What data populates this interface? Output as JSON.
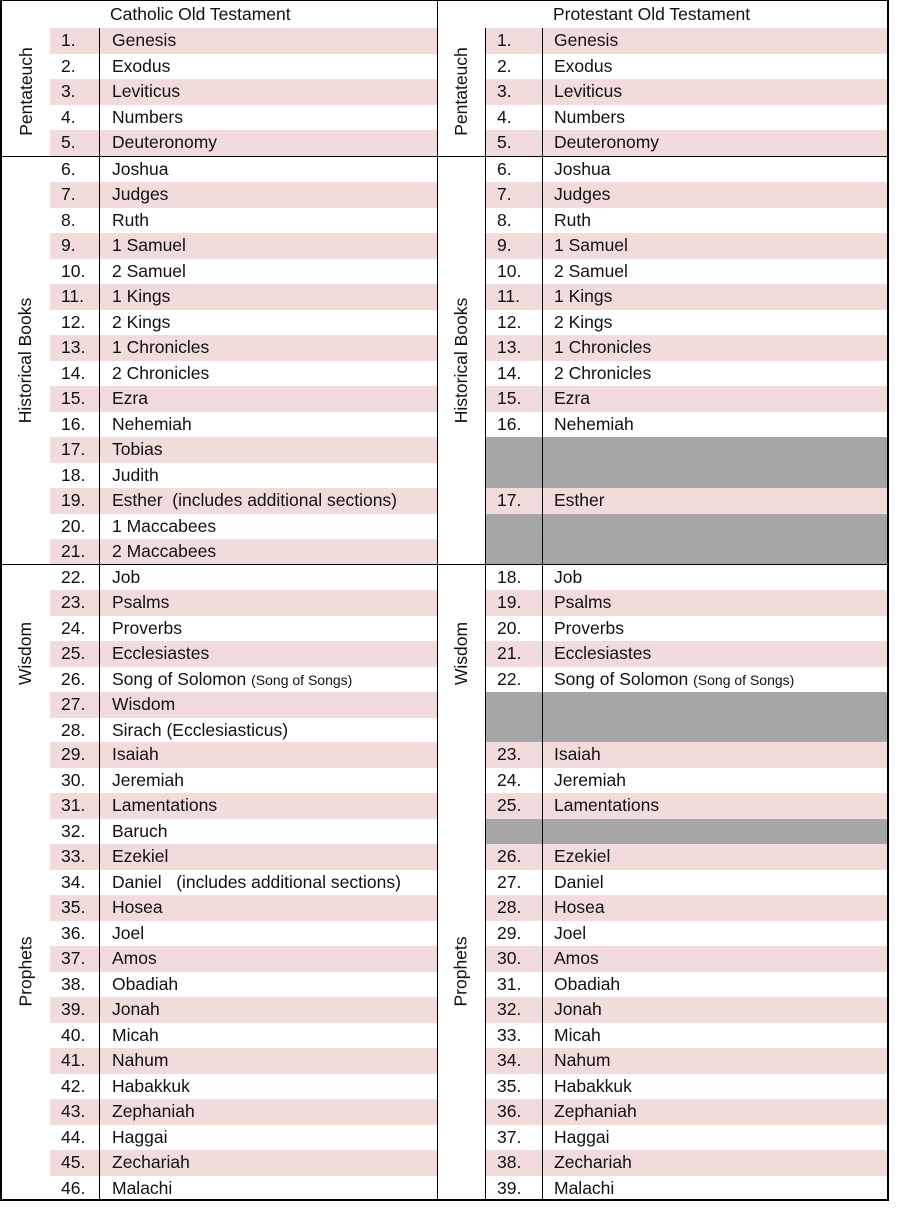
{
  "colors": {
    "stripe": "#f2dcdb",
    "missing": "#a6a6a6",
    "border": "#000000"
  },
  "catholic": {
    "title": "Catholic Old Testament",
    "sections": [
      {
        "label": "Pentateuch",
        "rows": [
          {
            "num": "1.",
            "name": "Genesis"
          },
          {
            "num": "2.",
            "name": "Exodus"
          },
          {
            "num": "3.",
            "name": "Leviticus"
          },
          {
            "num": "4.",
            "name": "Numbers"
          },
          {
            "num": "5.",
            "name": "Deuteronomy"
          }
        ]
      },
      {
        "label": "Historical Books",
        "rows": [
          {
            "num": "6.",
            "name": "Joshua"
          },
          {
            "num": "7.",
            "name": "Judges"
          },
          {
            "num": "8.",
            "name": "Ruth"
          },
          {
            "num": "9.",
            "name": "1 Samuel"
          },
          {
            "num": "10.",
            "name": "2 Samuel"
          },
          {
            "num": "11.",
            "name": "1 Kings"
          },
          {
            "num": "12.",
            "name": "2 Kings"
          },
          {
            "num": "13.",
            "name": "1 Chronicles"
          },
          {
            "num": "14.",
            "name": "2 Chronicles"
          },
          {
            "num": "15.",
            "name": "Ezra"
          },
          {
            "num": "16.",
            "name": "Nehemiah"
          },
          {
            "num": "17.",
            "name": "Tobias"
          },
          {
            "num": "18.",
            "name": "Judith"
          },
          {
            "num": "19.",
            "name": "Esther  (includes additional sections)"
          },
          {
            "num": "20.",
            "name": "1 Maccabees"
          },
          {
            "num": "21.",
            "name": "2 Maccabees"
          }
        ]
      },
      {
        "label": "Wisdom",
        "rows": [
          {
            "num": "22.",
            "name": "Job"
          },
          {
            "num": "23.",
            "name": "Psalms"
          },
          {
            "num": "24.",
            "name": "Proverbs"
          },
          {
            "num": "25.",
            "name": "Ecclesiastes"
          },
          {
            "num": "26.",
            "name": "Song of Solomon",
            "note": "(Song of Songs)"
          },
          {
            "num": "27.",
            "name": "Wisdom"
          },
          {
            "num": "28.",
            "name": "Sirach (Ecclesiasticus)"
          }
        ]
      },
      {
        "label": "Prophets",
        "rows": [
          {
            "num": "29.",
            "name": "Isaiah"
          },
          {
            "num": "30.",
            "name": "Jeremiah"
          },
          {
            "num": "31.",
            "name": "Lamentations"
          },
          {
            "num": "32.",
            "name": "Baruch"
          },
          {
            "num": "33.",
            "name": "Ezekiel"
          },
          {
            "num": "34.",
            "name": "Daniel   (includes additional sections)"
          },
          {
            "num": "35.",
            "name": "Hosea"
          },
          {
            "num": "36.",
            "name": "Joel"
          },
          {
            "num": "37.",
            "name": "Amos"
          },
          {
            "num": "38.",
            "name": "Obadiah"
          },
          {
            "num": "39.",
            "name": "Jonah"
          },
          {
            "num": "40.",
            "name": "Micah"
          },
          {
            "num": "41.",
            "name": "Nahum"
          },
          {
            "num": "42.",
            "name": "Habakkuk"
          },
          {
            "num": "43.",
            "name": "Zephaniah"
          },
          {
            "num": "44.",
            "name": "Haggai"
          },
          {
            "num": "45.",
            "name": "Zechariah"
          },
          {
            "num": "46.",
            "name": "Malachi"
          }
        ]
      }
    ]
  },
  "protestant": {
    "title": "Protestant Old Testament",
    "sections": [
      {
        "label": "Pentateuch",
        "rows": [
          {
            "num": "1.",
            "name": "Genesis"
          },
          {
            "num": "2.",
            "name": "Exodus"
          },
          {
            "num": "3.",
            "name": "Leviticus"
          },
          {
            "num": "4.",
            "name": "Numbers"
          },
          {
            "num": "5.",
            "name": "Deuteronomy"
          }
        ]
      },
      {
        "label": "Historical Books",
        "rows": [
          {
            "num": "6.",
            "name": "Joshua"
          },
          {
            "num": "7.",
            "name": "Judges"
          },
          {
            "num": "8.",
            "name": "Ruth"
          },
          {
            "num": "9.",
            "name": "1 Samuel"
          },
          {
            "num": "10.",
            "name": "2 Samuel"
          },
          {
            "num": "11.",
            "name": "1 Kings"
          },
          {
            "num": "12.",
            "name": "2 Kings"
          },
          {
            "num": "13.",
            "name": "1 Chronicles"
          },
          {
            "num": "14.",
            "name": "2 Chronicles"
          },
          {
            "num": "15.",
            "name": "Ezra"
          },
          {
            "num": "16.",
            "name": "Nehemiah"
          },
          {
            "missing": true
          },
          {
            "missing": true
          },
          {
            "num": "17.",
            "name": "Esther"
          },
          {
            "missing": true
          },
          {
            "missing": true
          }
        ]
      },
      {
        "label": "Wisdom",
        "rows": [
          {
            "num": "18.",
            "name": "Job"
          },
          {
            "num": "19.",
            "name": "Psalms"
          },
          {
            "num": "20.",
            "name": "Proverbs"
          },
          {
            "num": "21.",
            "name": "Ecclesiastes"
          },
          {
            "num": "22.",
            "name": "Song of Solomon",
            "note": "(Song of Songs)"
          },
          {
            "missing": true
          },
          {
            "missing": true
          }
        ]
      },
      {
        "label": "Prophets",
        "rows": [
          {
            "num": "23.",
            "name": "Isaiah"
          },
          {
            "num": "24.",
            "name": "Jeremiah"
          },
          {
            "num": "25.",
            "name": "Lamentations"
          },
          {
            "missing": true
          },
          {
            "num": "26.",
            "name": "Ezekiel"
          },
          {
            "num": "27.",
            "name": "Daniel"
          },
          {
            "num": "28.",
            "name": "Hosea"
          },
          {
            "num": "29.",
            "name": "Joel"
          },
          {
            "num": "30.",
            "name": "Amos"
          },
          {
            "num": "31.",
            "name": "Obadiah"
          },
          {
            "num": "32.",
            "name": "Jonah"
          },
          {
            "num": "33.",
            "name": "Micah"
          },
          {
            "num": "34.",
            "name": "Nahum"
          },
          {
            "num": "35.",
            "name": "Habakkuk"
          },
          {
            "num": "36.",
            "name": "Zephaniah"
          },
          {
            "num": "37.",
            "name": "Haggai"
          },
          {
            "num": "38.",
            "name": "Zechariah"
          },
          {
            "num": "39.",
            "name": "Malachi"
          }
        ]
      }
    ]
  }
}
